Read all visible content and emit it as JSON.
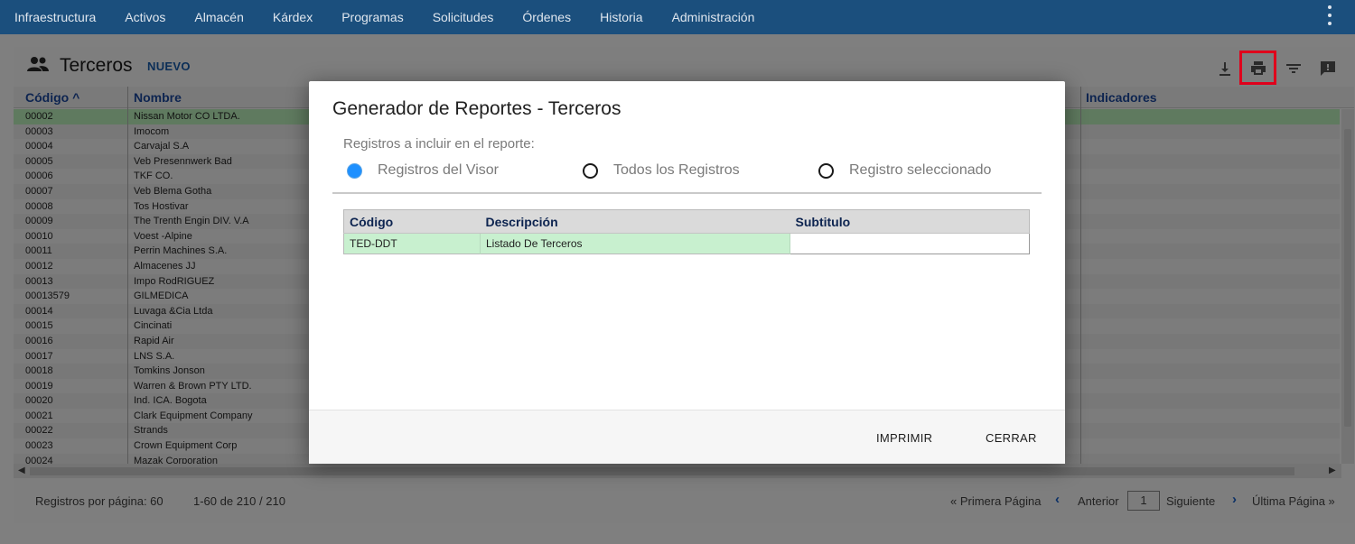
{
  "nav": {
    "items": [
      "Infraestructura",
      "Activos",
      "Almacén",
      "Kárdex",
      "Programas",
      "Solicitudes",
      "Órdenes",
      "Historia",
      "Administración"
    ]
  },
  "page": {
    "title": "Terceros",
    "new_label": "NUEVO",
    "icons": {
      "people": "people-icon",
      "download": "download-icon",
      "print": "print-icon",
      "filter": "filter-icon",
      "feedback": "feedback-icon"
    },
    "highlight_color": "#e0001b"
  },
  "grid": {
    "columns": {
      "codigo": "Código ^",
      "nombre": "Nombre",
      "indicadores": "Indicadores"
    },
    "rows": [
      {
        "codigo": "00002",
        "nombre": "Nissan Motor CO LTDA."
      },
      {
        "codigo": "00003",
        "nombre": "Imocom"
      },
      {
        "codigo": "00004",
        "nombre": "Carvajal S.A"
      },
      {
        "codigo": "00005",
        "nombre": "Veb Presennwerk Bad"
      },
      {
        "codigo": "00006",
        "nombre": "TKF CO."
      },
      {
        "codigo": "00007",
        "nombre": "Veb Blema Gotha"
      },
      {
        "codigo": "00008",
        "nombre": "Tos Hostivar"
      },
      {
        "codigo": "00009",
        "nombre": "The Trenth Engin DIV. V.A"
      },
      {
        "codigo": "00010",
        "nombre": "Voest -Alpine"
      },
      {
        "codigo": "00011",
        "nombre": "Perrin Machines S.A."
      },
      {
        "codigo": "00012",
        "nombre": "Almacenes JJ"
      },
      {
        "codigo": "00013",
        "nombre": "Impo RodRIGUEZ"
      },
      {
        "codigo": "00013579",
        "nombre": "GILMEDICA"
      },
      {
        "codigo": "00014",
        "nombre": "Luvaga &Cia Ltda"
      },
      {
        "codigo": "00015",
        "nombre": "Cincinati"
      },
      {
        "codigo": "00016",
        "nombre": "Rapid Air"
      },
      {
        "codigo": "00017",
        "nombre": "LNS S.A."
      },
      {
        "codigo": "00018",
        "nombre": "Tomkins Jonson"
      },
      {
        "codigo": "00019",
        "nombre": "Warren & Brown PTY LTD."
      },
      {
        "codigo": "00020",
        "nombre": "Ind. ICA. Bogota"
      },
      {
        "codigo": "00021",
        "nombre": "Clark Equipment Company"
      },
      {
        "codigo": "00022",
        "nombre": "Strands"
      },
      {
        "codigo": "00023",
        "nombre": "Crown Equipment Corp"
      },
      {
        "codigo": "00024",
        "nombre": "Mazak Corporation"
      }
    ],
    "selected_index": 0
  },
  "footer": {
    "per_page": "Registros por página: 60",
    "range": "1-60 de 210 / 210",
    "first": "« Primera Página",
    "prev": "Anterior",
    "page": "1",
    "next": "Siguiente",
    "last": "Última Página »"
  },
  "modal": {
    "title": "Generador de Reportes - Terceros",
    "records_label": "Registros a incluir en el reporte:",
    "options": [
      "Registros del Visor",
      "Todos los Registros",
      "Registro seleccionado"
    ],
    "selected_option": 0,
    "table": {
      "headers": [
        "Código",
        "Descripción",
        "Subtitulo"
      ],
      "row": {
        "codigo": "TED-DDT",
        "descripcion": "Listado De Terceros",
        "subtitulo": ""
      }
    },
    "print_label": "IMPRIMIR",
    "close_label": "CERRAR"
  }
}
